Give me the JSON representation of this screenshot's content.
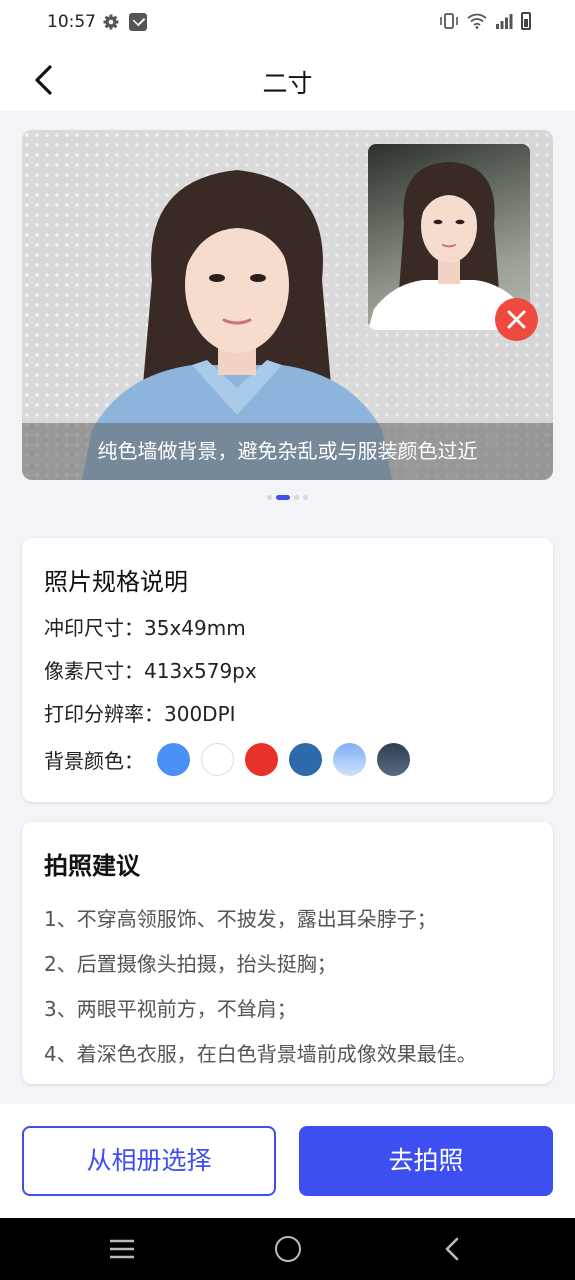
{
  "status_bar": {
    "time": "10:57"
  },
  "header": {
    "title": "二寸"
  },
  "banner": {
    "caption": "纯色墙做背景，避免杂乱或与服装颜色过近",
    "dot_count": 4,
    "active_dot": 1
  },
  "spec": {
    "title": "照片规格说明",
    "print_size": "冲印尺寸：35x49mm",
    "pixel_size": "像素尺寸：413x579px",
    "dpi": "打印分辨率：300DPI",
    "colors_label": "背景颜色：",
    "colors": [
      "#4a90f5",
      "#ffffff",
      "#e8312a",
      "#2e6aaa",
      "gradient:#7fb0f7-#cfe2fb",
      "gradient:#2f3d52-#5a6c82"
    ]
  },
  "tips": {
    "title": "拍照建议",
    "items": [
      "1、不穿高领服饰、不披发，露出耳朵脖子；",
      "2、后置摄像头拍摄，抬头挺胸；",
      "3、两眼平视前方，不耸肩；",
      "4、着深色衣服，在白色背景墙前成像效果最佳。"
    ]
  },
  "actions": {
    "album": "从相册选择",
    "camera": "去拍照"
  },
  "accent_color": "#3d4ff0"
}
